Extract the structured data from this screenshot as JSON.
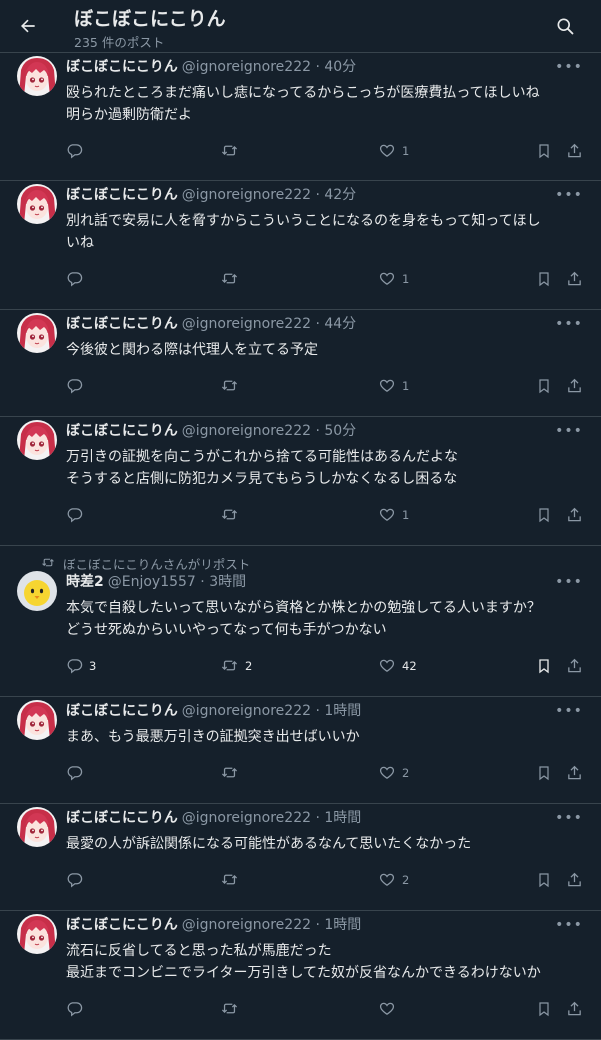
{
  "header": {
    "title": "ぼこぼこにこりん",
    "subtitle": "235 件のポスト"
  },
  "tweets": [
    {
      "name": "ぼこぼこにこりん",
      "handle": "@ignoreignore222 · 40分",
      "lines": [
        "殴られたところまだ痛いし痣になってるからこっちが医療費払ってほしいね",
        "明らか過剰防衛だよ"
      ],
      "reply": "",
      "retweet": "",
      "like": "1",
      "avatar": "girl"
    },
    {
      "name": "ぼこぼこにこりん",
      "handle": "@ignoreignore222 · 42分",
      "lines": [
        "別れ話で安易に人を脅すからこういうことになるのを身をもって知ってほし",
        "いね"
      ],
      "reply": "",
      "retweet": "",
      "like": "1",
      "avatar": "girl"
    },
    {
      "name": "ぼこぼこにこりん",
      "handle": "@ignoreignore222 · 44分",
      "lines": [
        "今後彼と関わる際は代理人を立てる予定"
      ],
      "reply": "",
      "retweet": "",
      "like": "1",
      "avatar": "girl"
    },
    {
      "name": "ぼこぼこにこりん",
      "handle": "@ignoreignore222 · 50分",
      "lines": [
        "万引きの証拠を向こうがこれから捨てる可能性はあるんだよな",
        "そうすると店側に防犯カメラ見てもらうしかなくなるし困るな"
      ],
      "reply": "",
      "retweet": "",
      "like": "1",
      "avatar": "girl"
    },
    {
      "retweeted_by": "ぼこぼこにこりんさんがリポスト",
      "name": "時差2",
      "handle": "@Enjoy1557 · 3時間",
      "lines": [
        "本気で自殺したいって思いながら資格とか株とかの勉強してる人いますか？",
        "どうせ死ぬからいいやってなって何も手がつかない"
      ],
      "reply": "3",
      "retweet": "2",
      "like": "42",
      "avatar": "chick"
    },
    {
      "name": "ぼこぼこにこりん",
      "handle": "@ignoreignore222 · 1時間",
      "lines": [
        "まあ、もう最悪万引きの証拠突き出せばいいか"
      ],
      "reply": "",
      "retweet": "",
      "like": "2",
      "avatar": "girl"
    },
    {
      "name": "ぼこぼこにこりん",
      "handle": "@ignoreignore222 · 1時間",
      "lines": [
        "最愛の人が訴訟関係になる可能性があるなんて思いたくなかった"
      ],
      "reply": "",
      "retweet": "",
      "like": "2",
      "avatar": "girl"
    },
    {
      "name": "ぼこぼこにこりん",
      "handle": "@ignoreignore222 · 1時間",
      "lines": [
        "流石に反省してると思った私が馬鹿だった",
        "最近までコンビニでライター万引きしてた奴が反省なんかできるわけないか"
      ],
      "reply": "",
      "retweet": "",
      "like": "",
      "avatar": "girl"
    }
  ],
  "icons": {
    "back": "arrow-left-icon",
    "search": "search-icon",
    "more": "more-icon",
    "reply": "reply-icon",
    "retweet": "retweet-icon",
    "like": "heart-icon",
    "bookmark": "bookmark-icon",
    "share": "share-icon"
  },
  "colors": {
    "background": "#15202b",
    "text": "#e7e9ea",
    "muted": "#8b98a5",
    "border": "#38444d"
  }
}
